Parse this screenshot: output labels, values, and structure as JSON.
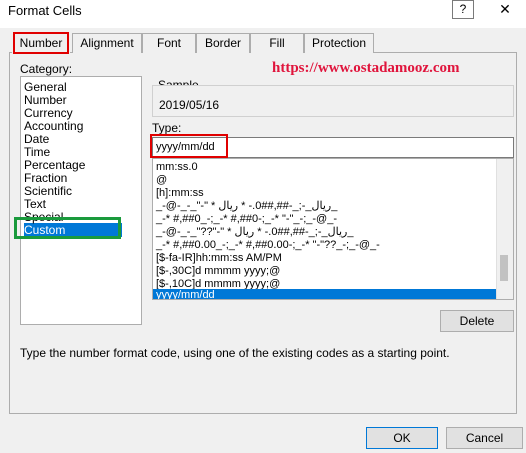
{
  "window": {
    "title": "Format Cells",
    "help_label": "?",
    "close_label": "✕"
  },
  "tabs": [
    {
      "label": "Number"
    },
    {
      "label": "Alignment"
    },
    {
      "label": "Font"
    },
    {
      "label": "Border"
    },
    {
      "label": "Fill"
    },
    {
      "label": "Protection"
    }
  ],
  "category": {
    "label": "Category:",
    "items": [
      "General",
      "Number",
      "Currency",
      "Accounting",
      "Date",
      "Time",
      "Percentage",
      "Fraction",
      "Scientific",
      "Text",
      "Special",
      "Custom"
    ],
    "selected": "Custom"
  },
  "watermark_url": "https://www.ostadamooz.com",
  "sample": {
    "label": "Sample",
    "value": "2019/05/16"
  },
  "type": {
    "label": "Type:",
    "value": "yyyy/mm/dd"
  },
  "formats": [
    "mm:ss.0",
    "@",
    "[h]:mm:ss",
    "_-@-_-_\"-\" * ریال_-;_-##,##0.- * ریال_",
    "_-* #,##0_-;_-* #,##0-;_-* \"-\"_-;_-@_-",
    "_-@-_-_\"??\"-\" * ریال_-;_-##,##0.- * ریال_",
    "_-* #,##0.00_-;_-* #,##0.00-;_-* \"-\"??_-;_-@_-",
    "[$-fa-IR]hh:mm:ss AM/PM",
    "[$-,30C]d mmmm yyyy;@",
    "[$-,10C]d mmmm yyyy;@",
    "yyyy/mm/dd"
  ],
  "selected_format": "yyyy/mm/dd",
  "delete_label": "Delete",
  "description": "Type the number format code, using one of the existing codes as a starting point.",
  "ok_label": "OK",
  "cancel_label": "Cancel",
  "colors": {
    "selection": "#0078d7",
    "highlight_red": "#e00000",
    "highlight_green": "#1a9a3c",
    "url_red": "#e0143c"
  }
}
